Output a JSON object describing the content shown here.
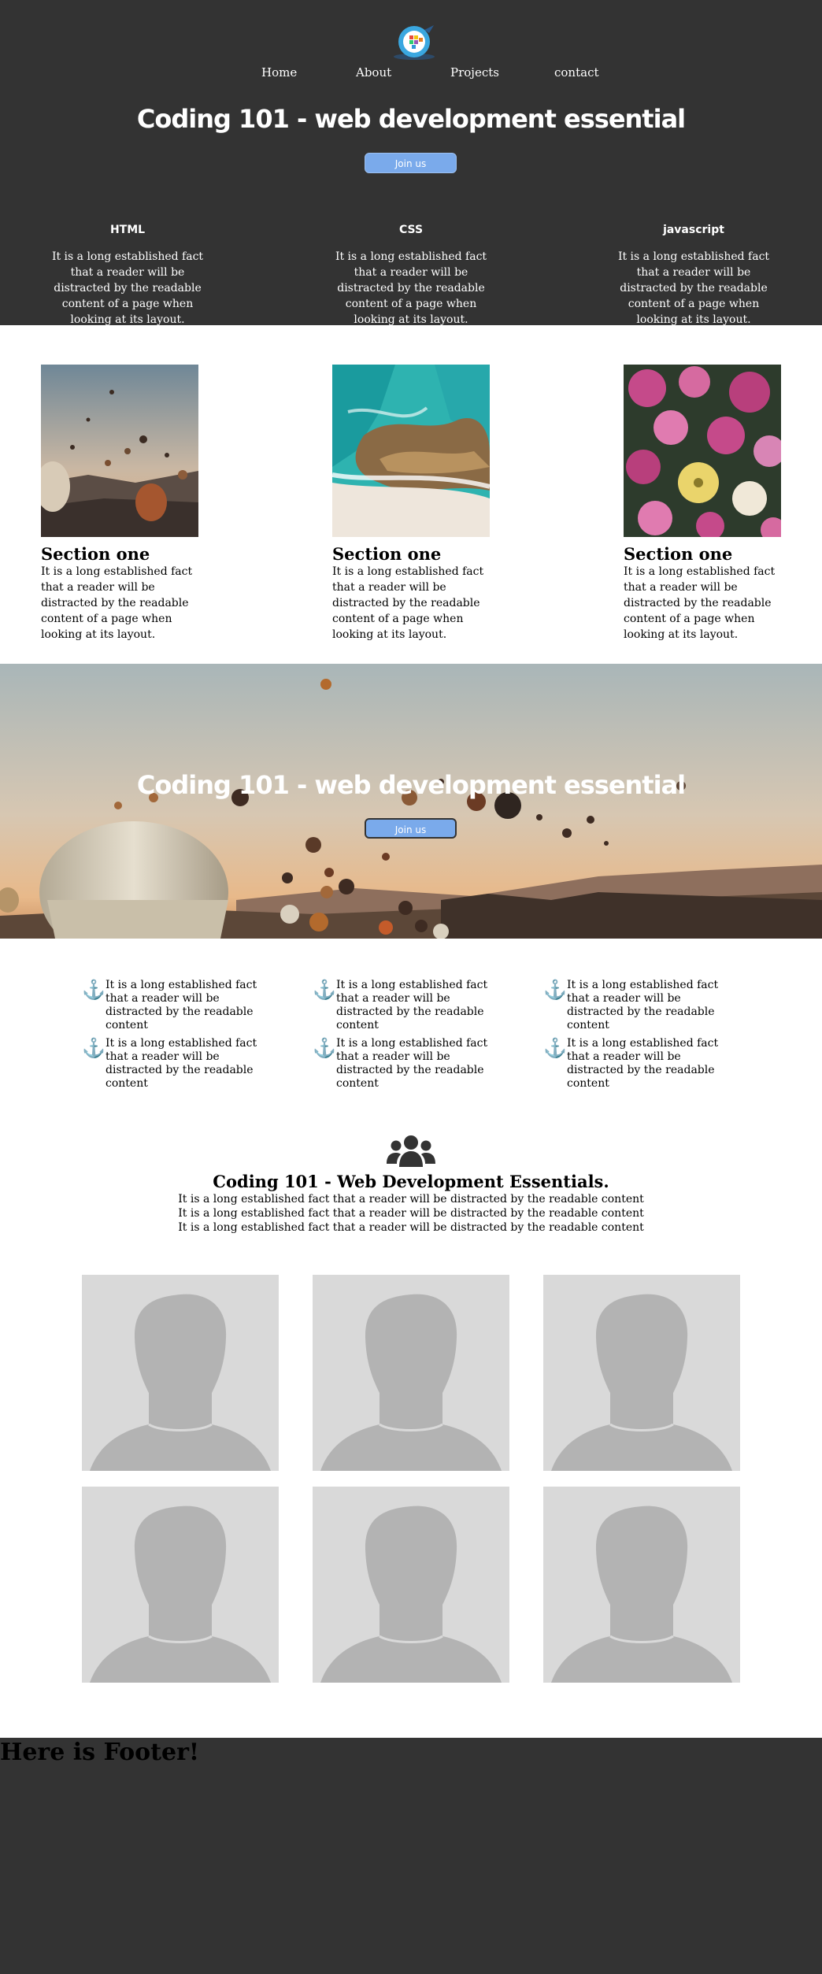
{
  "nav": {
    "items": [
      "Home",
      "About",
      "Projects",
      "contact"
    ]
  },
  "hero": {
    "title": "Coding 101 - web development essential",
    "join_label": "Join us"
  },
  "topics": [
    {
      "heading": "HTML",
      "text": "It is a long established fact that a reader will be distracted by the readable content of a page when looking at its layout."
    },
    {
      "heading": "CSS",
      "text": "It is a long established fact that a reader will be distracted by the readable content of a page when looking at its layout."
    },
    {
      "heading": "javascript",
      "text": "It is a long established fact that a reader will be distracted by the readable content of a page when looking at its layout."
    }
  ],
  "sections": [
    {
      "title": "Section one",
      "text": "It is a long established fact that a reader will be distracted by the readable content of a page when looking at its layout.",
      "image": "hot-air-balloons-photo"
    },
    {
      "title": "Section one",
      "text": "It is a long established fact that a reader will be distracted by the readable content of a page when looking at its layout.",
      "image": "ocean-shore-aerial-photo"
    },
    {
      "title": "Section one",
      "text": "It is a long established fact that a reader will be distracted by the readable content of a page when looking at its layout.",
      "image": "pink-flowers-photo"
    }
  ],
  "banner": {
    "title": "Coding 101 - web development essential",
    "join_label": "Join us",
    "image": "hot-air-balloons-landscape-photo"
  },
  "features": [
    {
      "icon": "anchor-icon",
      "text": "It is a long established fact that a reader will be distracted by the readable content"
    },
    {
      "icon": "anchor-icon",
      "text": "It is a long established fact that a reader will be distracted by the readable content"
    },
    {
      "icon": "anchor-icon",
      "text": "It is a long established fact that a reader will be distracted by the readable content"
    },
    {
      "icon": "anchor-icon",
      "text": "It is a long established fact that a reader will be distracted by the readable content"
    },
    {
      "icon": "anchor-icon",
      "text": "It is a long established fact that a reader will be distracted by the readable content"
    },
    {
      "icon": "anchor-icon",
      "text": "It is a long established fact that a reader will be distracted by the readable content"
    }
  ],
  "team": {
    "icon": "users-icon",
    "title": "Coding 101 - Web Development Essentials.",
    "lines": [
      "It is a long established fact that a reader will be distracted by the readable content",
      "It is a long established fact that a reader will be distracted by the readable content",
      "It is a long established fact that a reader will be distracted by the readable content"
    ],
    "avatar_icon": "person-placeholder-icon"
  },
  "footer": {
    "text": "Here is Footer!"
  },
  "colors": {
    "dark_bg": "#333333",
    "button": "#7aaaeb",
    "avatar_bg": "#d9d9d9",
    "avatar_fg": "#b3b3b3"
  }
}
